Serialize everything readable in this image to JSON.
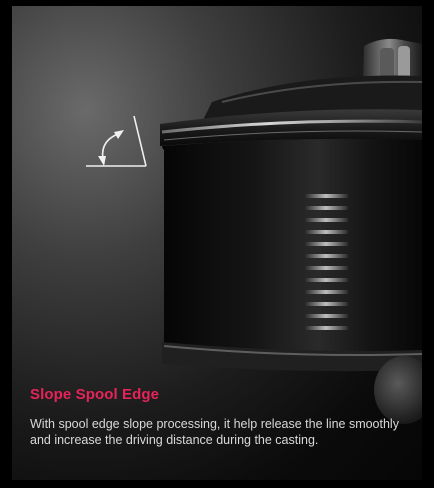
{
  "caption": {
    "title": "Slope Spool Edge",
    "body": "With spool edge slope processing, it help release the line smoothly and increase the driving distance during the casting."
  },
  "colors": {
    "accent": "#e8235a",
    "text": "#d9d9d9",
    "background": "#000000"
  },
  "icons": {
    "angle": "slope-angle-icon"
  }
}
